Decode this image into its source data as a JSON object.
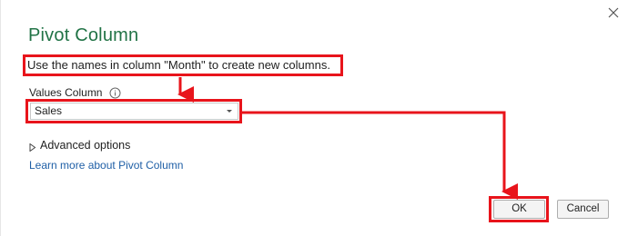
{
  "dialog": {
    "title": "Pivot Column",
    "description": "Use the names in column \"Month\" to create new columns.",
    "values_column_label": "Values Column",
    "values_column_selected": "Sales",
    "advanced_options_label": "Advanced options",
    "learn_more_link": "Learn more about Pivot Column",
    "ok_label": "OK",
    "cancel_label": "Cancel"
  },
  "icons": {
    "close": "close-icon",
    "info": "info-icon",
    "dropdown": "chevron-down-icon",
    "expand": "triangle-right-icon"
  },
  "colors": {
    "title": "#217346",
    "link": "#1f5fa6",
    "annotation": "#e8141b"
  }
}
